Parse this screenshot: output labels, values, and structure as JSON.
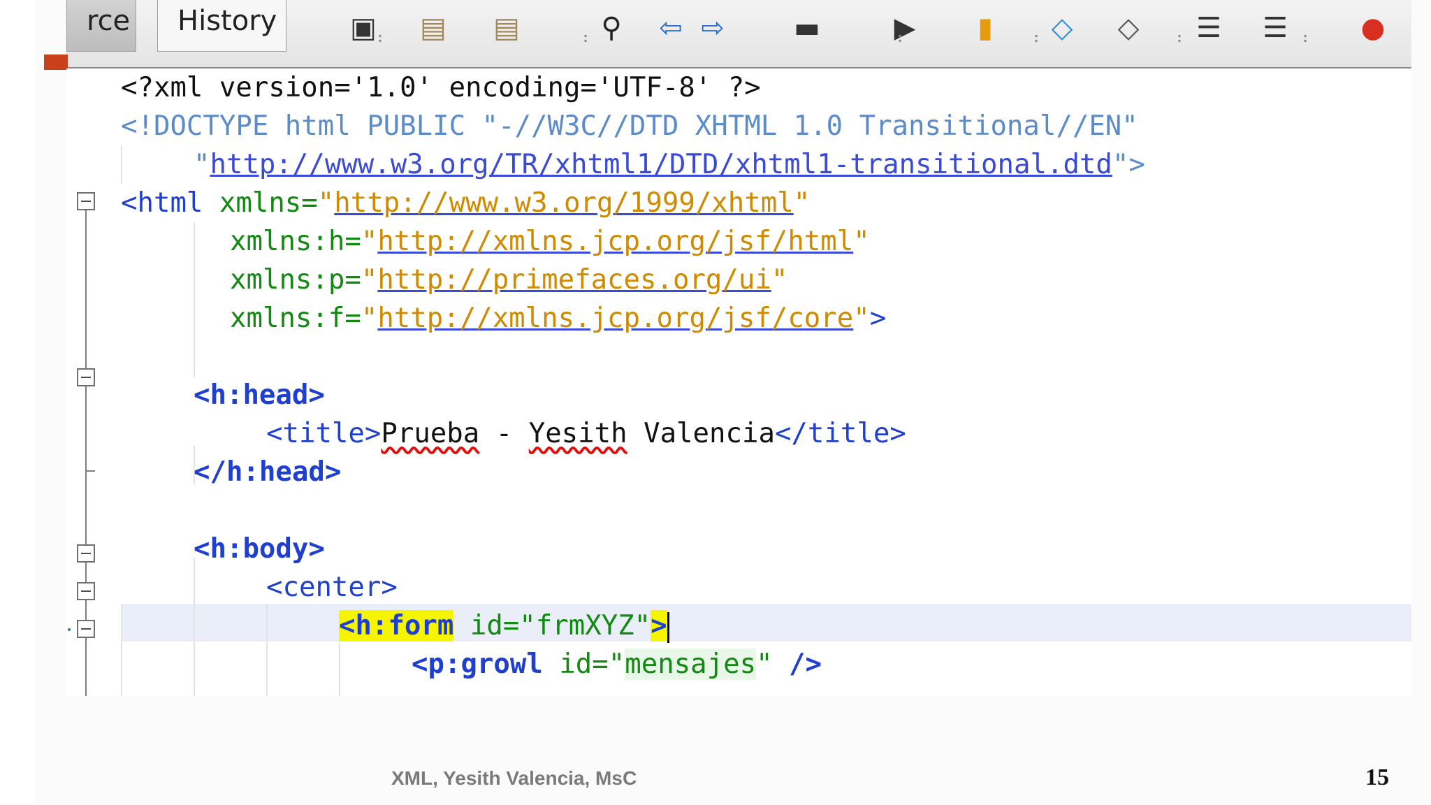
{
  "toolbar": {
    "tabs": [
      {
        "label": "rce",
        "name": "tab-source"
      },
      {
        "label": "History",
        "name": "tab-history"
      }
    ],
    "icons": [
      {
        "name": "last-edit-icon",
        "glyph": "▣",
        "color": "#333333"
      },
      {
        "name": "back-icon",
        "glyph": "▤",
        "color": "#a0865a"
      },
      {
        "name": "forward-icon",
        "glyph": "▤",
        "color": "#a0865a"
      },
      {
        "name": "search-icon",
        "glyph": "⚲",
        "color": "#222222"
      },
      {
        "name": "find-previous-icon",
        "glyph": "⇦",
        "color": "#2f6fd0"
      },
      {
        "name": "find-next-icon",
        "glyph": "⇨",
        "color": "#2f6fd0"
      },
      {
        "name": "toggle-highlight-icon",
        "glyph": "▬",
        "color": "#333333"
      },
      {
        "name": "run-icon",
        "glyph": "▶",
        "color": "#333333"
      },
      {
        "name": "bookmark-icon",
        "glyph": "▮",
        "color": "#e89a10"
      },
      {
        "name": "shift-left-icon",
        "glyph": "◇",
        "color": "#2f8fd0"
      },
      {
        "name": "shift-right-icon",
        "glyph": "◇",
        "color": "#555555"
      },
      {
        "name": "comment-icon",
        "glyph": "☰",
        "color": "#333333"
      },
      {
        "name": "uncomment-icon",
        "glyph": "☰",
        "color": "#333333"
      },
      {
        "name": "stop-macro-icon",
        "glyph": "●",
        "color": "#d83020"
      }
    ]
  },
  "code": {
    "line1": {
      "pi": "<?xml version='1.0' encoding='UTF-8' ?>"
    },
    "line2": {
      "doctype": "<!DOCTYPE html PUBLIC \"-//W3C//DTD XHTML 1.0 Transitional//EN\""
    },
    "line3": {
      "q1": "\"",
      "url": "http://www.w3.org/TR/xhtml1/DTD/xhtml1-transitional.dtd",
      "q2": "\">"
    },
    "line4": {
      "tag": "<html",
      "attr": " xmlns=",
      "q1": "\"",
      "url": "http://www.w3.org/1999/xhtml",
      "q2": "\""
    },
    "line5": {
      "attr": "xmlns:h=",
      "q1": "\"",
      "url": "http://xmlns.jcp.org/jsf/html",
      "q2": "\""
    },
    "line6": {
      "attr": "xmlns:p=",
      "q1": "\"",
      "url": "http://primefaces.org/ui",
      "q2": "\""
    },
    "line7": {
      "attr": "xmlns:f=",
      "q1": "\"",
      "url": "http://xmlns.jcp.org/jsf/core",
      "q2": "\"",
      "close": ">"
    },
    "line9": {
      "tag": "<h:head>"
    },
    "line10": {
      "open": "<title>",
      "w1": "Prueba",
      "sep": " - ",
      "w2": "Yesith",
      "w3": " Valencia",
      "close": "</title>"
    },
    "line11": {
      "tag": "</h:head>"
    },
    "line13": {
      "tag": "<h:body>"
    },
    "line14": {
      "tag": "<center>"
    },
    "line15": {
      "tag": "<h:form",
      "attr": " id=",
      "val": "\"frmXYZ\"",
      "close": ">"
    },
    "line16": {
      "tag": "<p:growl",
      "attr": " id=",
      "q1": "\"",
      "val": "mensajes",
      "q2": "\"",
      "close": " />"
    }
  },
  "footer": {
    "text": "XML, Yesith Valencia, MsC",
    "page": "15"
  }
}
